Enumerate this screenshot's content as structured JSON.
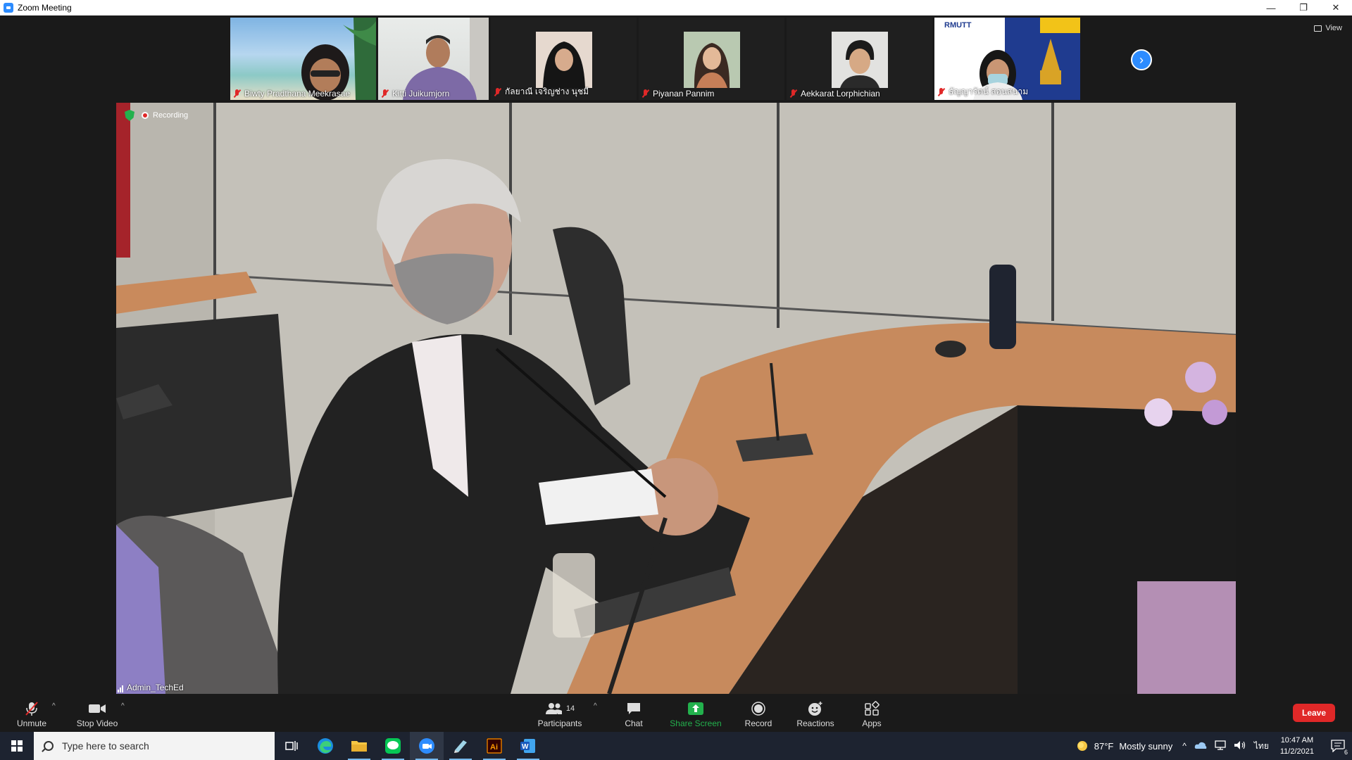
{
  "window": {
    "title": "Zoom Meeting"
  },
  "window_controls": {
    "minimize": "—",
    "restore": "❐",
    "close": "✕"
  },
  "participants_strip": [
    {
      "name": "Biwty Pradthana Meekrasae",
      "muted": true
    },
    {
      "name": "Kitti Juikumjorn",
      "muted": true
    },
    {
      "name": "กัลยาณี เจริญช่าง นุชมี",
      "muted": true
    },
    {
      "name": "Piyanan Pannim",
      "muted": true
    },
    {
      "name": "Aekkarat Lorphichian",
      "muted": true
    },
    {
      "name": "ธัญญารัตน์ สอนสนาม",
      "muted": true,
      "badge": "RMUTT"
    }
  ],
  "view_button": {
    "label": "View"
  },
  "main_video": {
    "recording_label": "Recording",
    "speaker_name": "Admin_TechEd"
  },
  "toolbar": {
    "unmute_label": "Unmute",
    "stop_video_label": "Stop Video",
    "participants_label": "Participants",
    "participants_count": "14",
    "chat_label": "Chat",
    "share_screen_label": "Share Screen",
    "record_label": "Record",
    "reactions_label": "Reactions",
    "apps_label": "Apps",
    "leave_label": "Leave"
  },
  "taskbar": {
    "search_placeholder": "Type here to search",
    "weather_temp": "87°F",
    "weather_text": "Mostly sunny",
    "language": "ไทย",
    "time": "10:47 AM",
    "date": "11/2/2021",
    "notification_count": "6"
  },
  "colors": {
    "zoom_blue": "#2d8cff",
    "leave_red": "#e02828",
    "share_green": "#23b14d",
    "taskbar_bg": "#1d2330"
  }
}
